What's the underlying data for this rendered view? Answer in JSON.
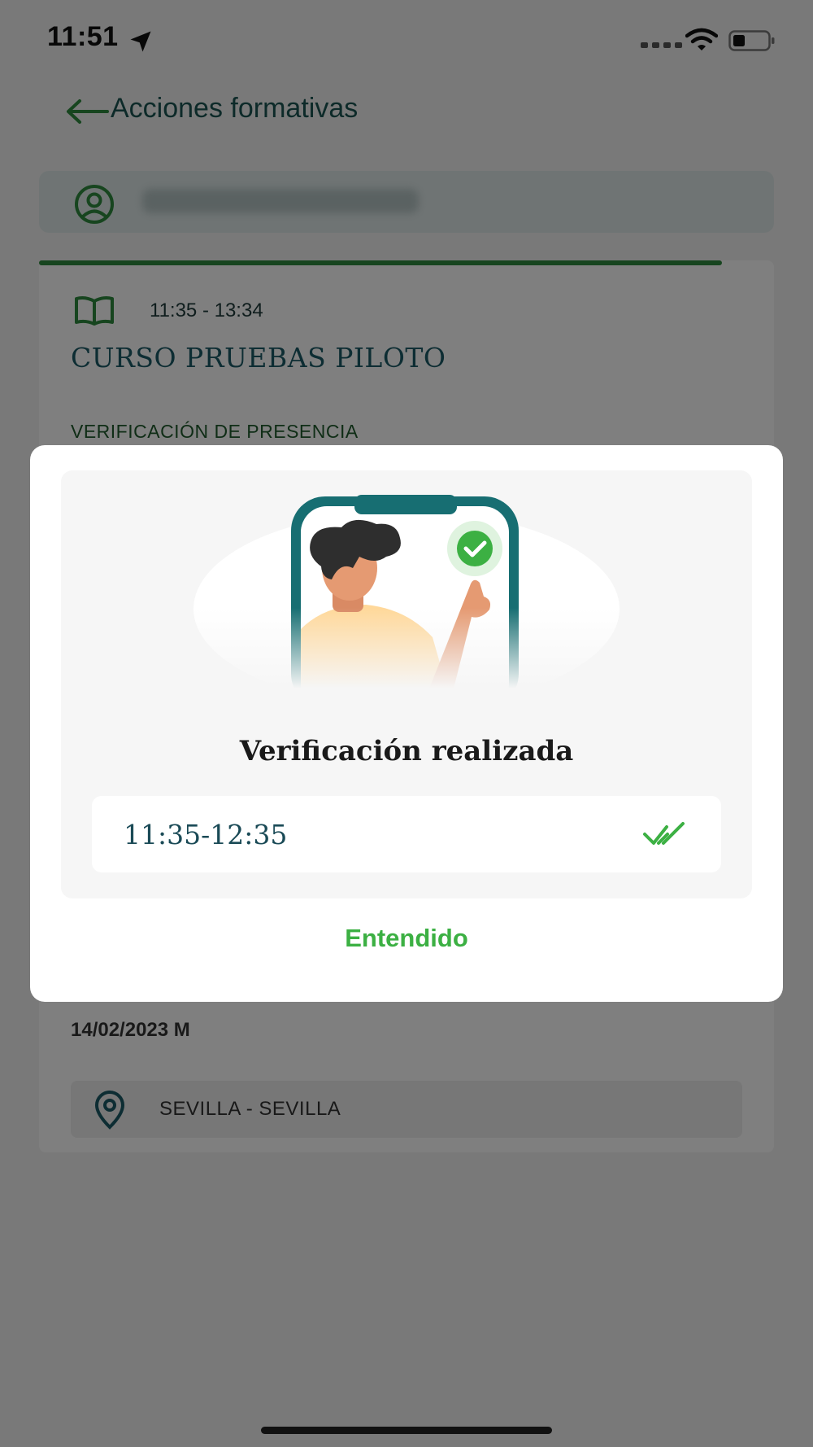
{
  "status_bar": {
    "time": "11:51",
    "icons": [
      "location-arrow-icon",
      "signal-icon",
      "wifi-icon",
      "battery-icon"
    ]
  },
  "header": {
    "back_icon": "arrow-left-icon",
    "title": "Acciones formativas"
  },
  "user_bar": {
    "icon": "user-circle-icon",
    "name_blurred": true
  },
  "course": {
    "icon": "book-open-icon",
    "time_range": "11:35 - 13:34",
    "title": "CURSO PRUEBAS PILOTO",
    "section_label": "VERIFICACIÓN DE PRESENCIA",
    "date": "14/02/2023 M",
    "location_icon": "map-pin-icon",
    "location": "SEVILLA - SEVILLA"
  },
  "modal": {
    "illustration": "person-pointing-at-phone-with-check-icon",
    "title": "Verificación realizada",
    "verified_slot": "11:35-12:35",
    "status_icon": "double-check-icon",
    "confirm_label": "Entendido"
  },
  "colors": {
    "accent_green": "#3cb043",
    "dark_teal": "#1a5552",
    "progress_green": "#2e8b3e",
    "overlay": "rgba(0,0,0,0.5)"
  }
}
